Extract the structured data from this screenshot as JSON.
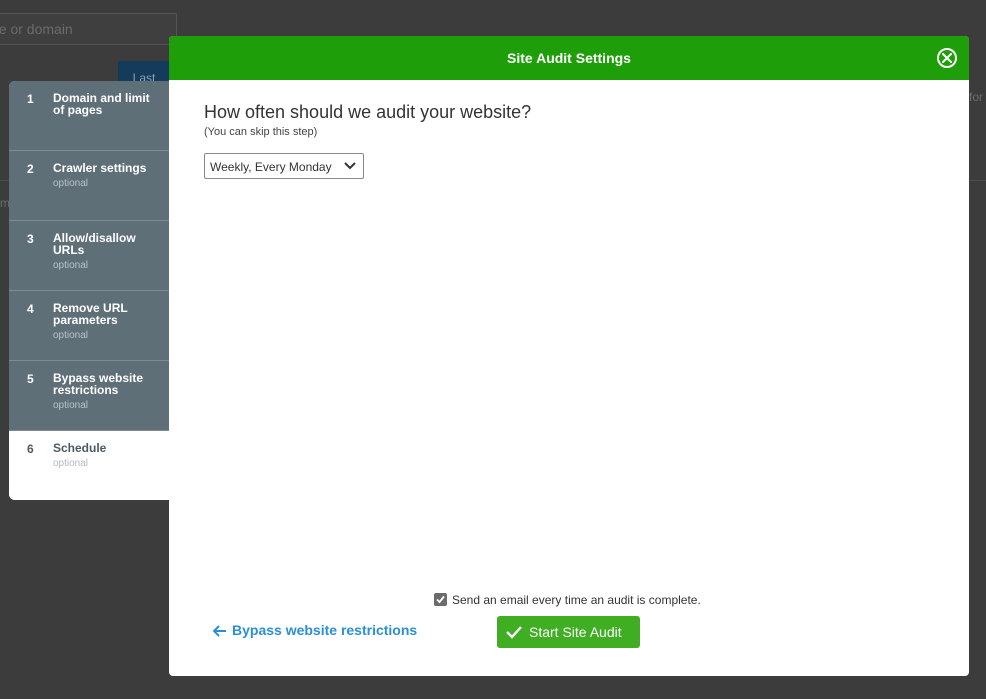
{
  "background": {
    "search_placeholder": "ne or domain",
    "button_label": "Last",
    "right_text": "for",
    "left_text": "m"
  },
  "steps": [
    {
      "number": "1",
      "title": "Domain and limit of pages",
      "subtitle": ""
    },
    {
      "number": "2",
      "title": "Crawler settings",
      "subtitle": "optional"
    },
    {
      "number": "3",
      "title": "Allow/disallow URLs",
      "subtitle": "optional"
    },
    {
      "number": "4",
      "title": "Remove URL parameters",
      "subtitle": "optional"
    },
    {
      "number": "5",
      "title": "Bypass website restrictions",
      "subtitle": "optional"
    },
    {
      "number": "6",
      "title": "Schedule",
      "subtitle": "optional",
      "active": true
    }
  ],
  "modal": {
    "title": "Site Audit Settings",
    "question": "How often should we audit your website?",
    "hint": "(You can skip this step)",
    "schedule_select": {
      "value": "Weekly, Every Monday"
    },
    "email_checkbox": {
      "label": "Send an email every time an audit is complete.",
      "checked": true
    },
    "back_link": "Bypass website restrictions",
    "start_button": "Start Site Audit"
  },
  "colors": {
    "header_green": "#1e9f0a",
    "button_green": "#3fae23",
    "link_blue": "#2b8fd6",
    "step_gray": "#5f6f78"
  },
  "icons": {
    "close": "close-circle-icon",
    "chevron": "chevron-down-icon",
    "check": "checkmark-icon",
    "back": "arrow-left-icon"
  }
}
